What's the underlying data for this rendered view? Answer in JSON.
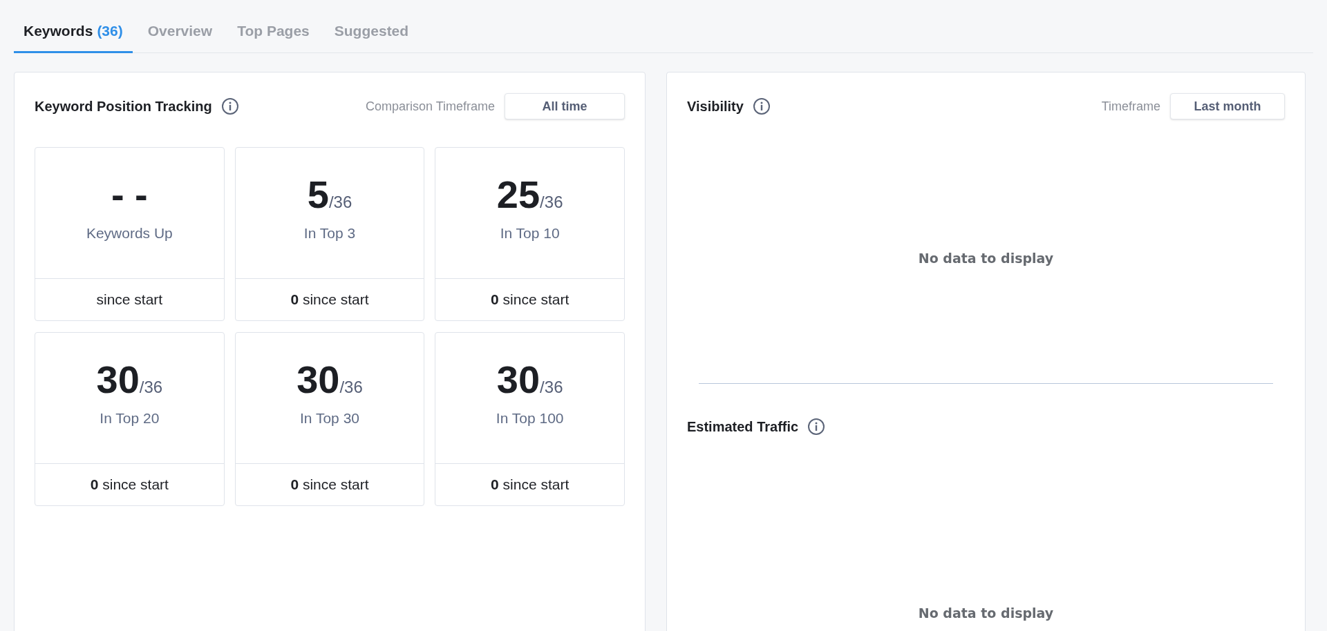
{
  "tabs": [
    {
      "label": "Keywords",
      "count": "(36)",
      "selected": true
    },
    {
      "label": "Overview",
      "selected": false
    },
    {
      "label": "Top Pages",
      "selected": false
    },
    {
      "label": "Suggested",
      "selected": false
    }
  ],
  "tracking": {
    "title": "Keyword Position Tracking",
    "timeframe_label": "Comparison Timeframe",
    "timeframe": "All time",
    "stats": [
      {
        "value": "- -",
        "label": "Keywords Up",
        "change": "since start"
      },
      {
        "value": "5",
        "total": "/36",
        "label": "In Top 3",
        "change": "**0** since start"
      },
      {
        "value": "25",
        "total": "/36",
        "label": "In Top 10",
        "change": "**0** since start"
      },
      {
        "value": "30",
        "total": "/36",
        "label": "In Top 20",
        "change": "**0** since start"
      },
      {
        "value": "30",
        "total": "/36",
        "label": "In Top 30",
        "change": "**0** since start"
      },
      {
        "value": "30",
        "total": "/36",
        "label": "In Top 100",
        "change": "**0** since start"
      }
    ]
  },
  "visibility": {
    "title": "Visibility",
    "timeframe_label": "Timeframe",
    "timeframe": "Last month",
    "empty_message": "No data to display"
  },
  "estimated_traffic": {
    "title": "Estimated Traffic",
    "empty_message": "No data to display"
  }
}
